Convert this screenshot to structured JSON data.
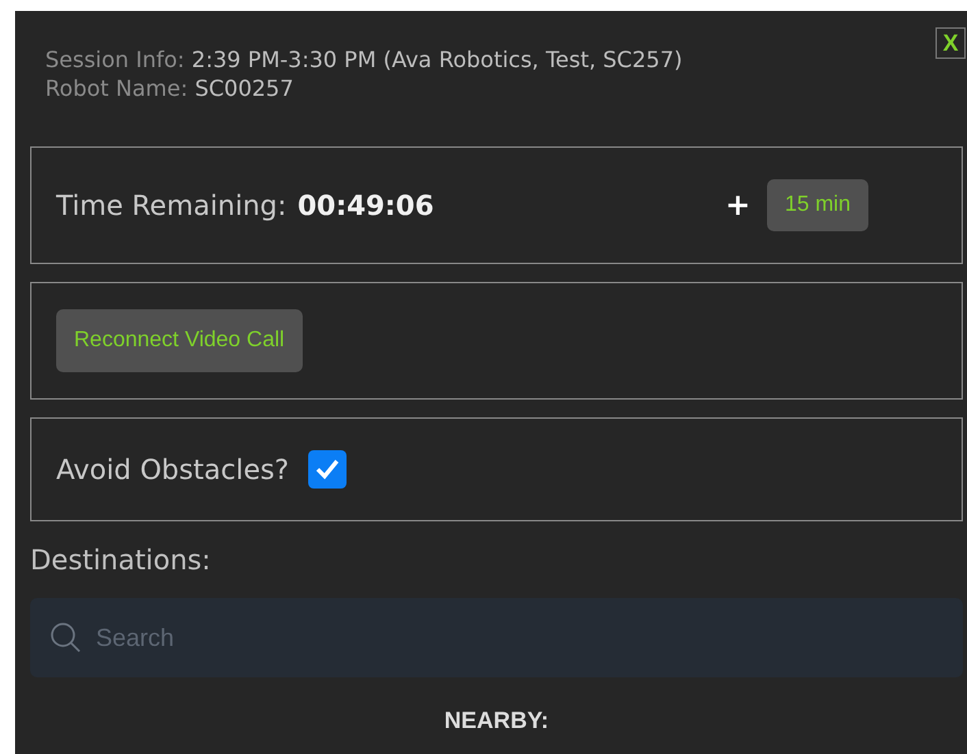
{
  "close_button": {
    "label": "X"
  },
  "session_info": {
    "label": "Session Info:",
    "value": "2:39 PM-3:30 PM (Ava Robotics, Test, SC257)"
  },
  "robot_name": {
    "label": "Robot Name:",
    "value": "SC00257"
  },
  "time_remaining": {
    "label": "Time Remaining:",
    "value": "00:49:06",
    "plus": "+",
    "extend_button": "15 min"
  },
  "reconnect_button": {
    "label": "Reconnect Video Call"
  },
  "avoid_obstacles": {
    "label": "Avoid Obstacles?",
    "checked": true
  },
  "destinations": {
    "label": "Destinations:",
    "search": {
      "placeholder": "Search"
    },
    "section": "NEARBY:"
  }
}
